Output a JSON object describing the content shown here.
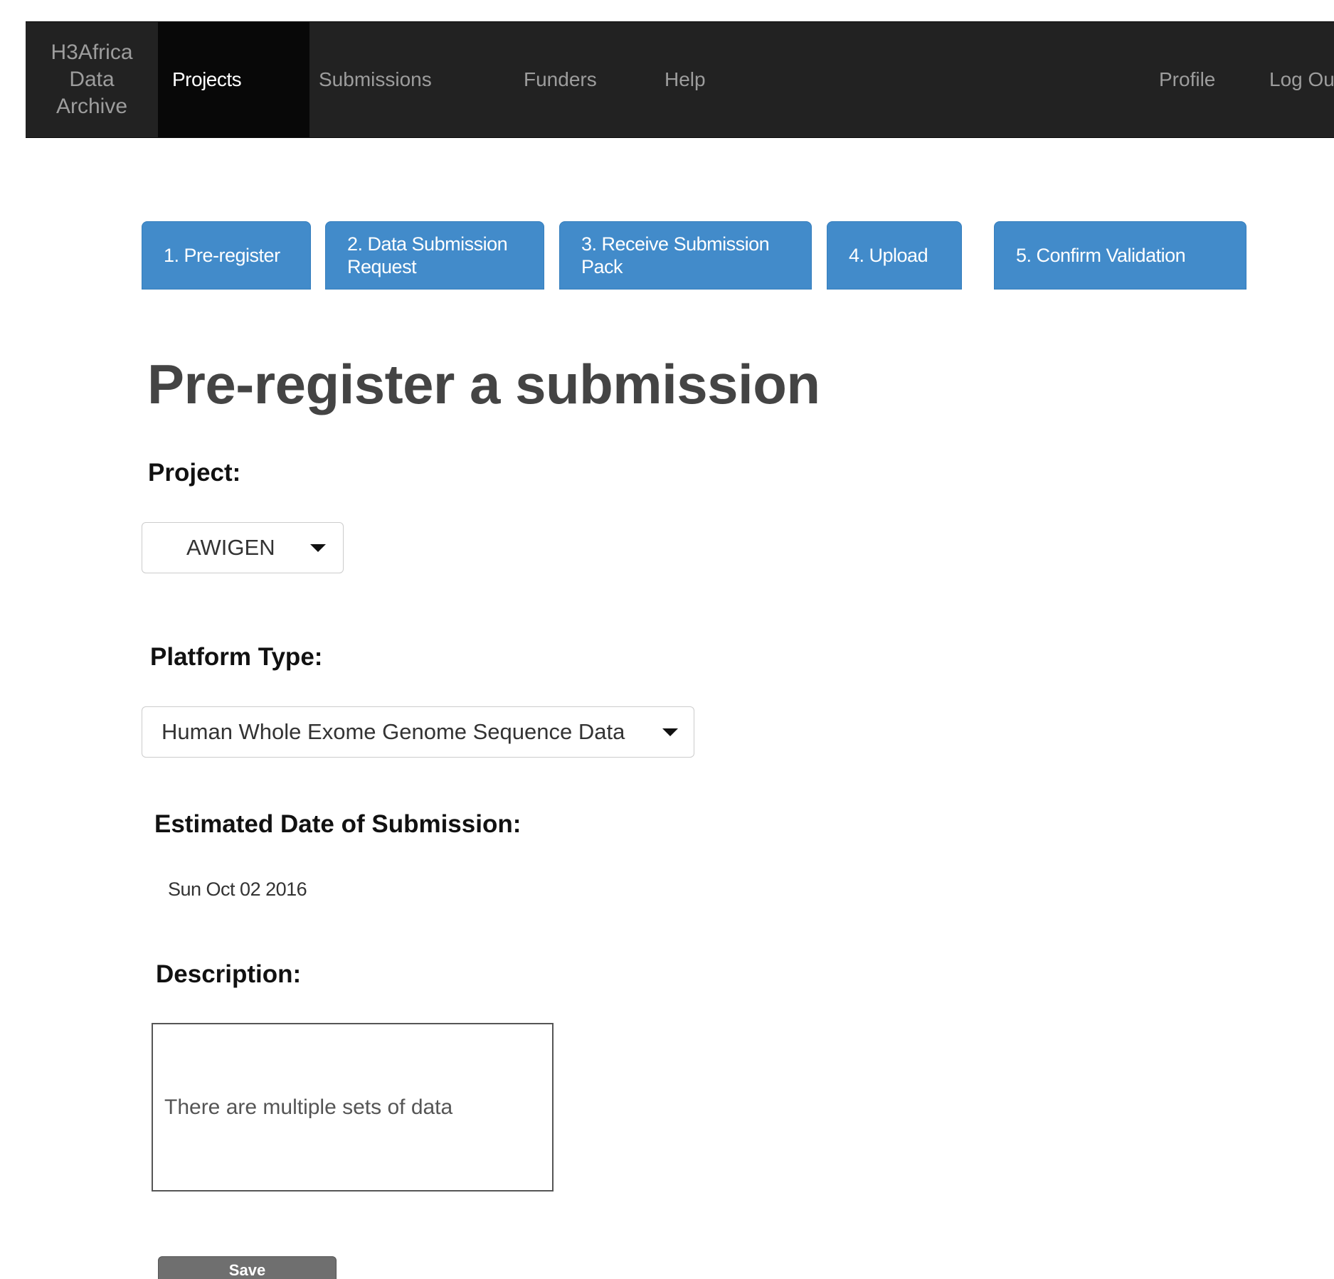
{
  "navbar": {
    "brand": {
      "line1": "H3Africa",
      "line2": "Data",
      "line3": "Archive"
    },
    "items": [
      {
        "label": "Projects",
        "active": true
      },
      {
        "label": "Submissions"
      },
      {
        "label": "Funders"
      },
      {
        "label": "Help"
      }
    ],
    "right_items": [
      {
        "label": "Profile"
      },
      {
        "label": "Log Ou"
      }
    ]
  },
  "steps": [
    {
      "label": "1. Pre-register"
    },
    {
      "label": "2. Data Submission Request"
    },
    {
      "label": "3. Receive Submission Pack"
    },
    {
      "label": "4. Upload"
    },
    {
      "label": "5. Confirm Validation"
    }
  ],
  "main": {
    "title": "Pre-register a submission",
    "project": {
      "label": "Project:",
      "value": "AWIGEN"
    },
    "platform": {
      "label": "Platform Type:",
      "value": "Human Whole Exome Genome Sequence Data"
    },
    "date": {
      "label": "Estimated Date of Submission:",
      "value": "Sun Oct 02 2016"
    },
    "description": {
      "label": "Description:",
      "value": "There are multiple sets of data"
    },
    "save_label": "Save"
  },
  "colors": {
    "navbar_bg": "#222222",
    "navbar_active_bg": "#080808",
    "step_bg": "#428bca",
    "save_bg": "#6f6f6f"
  }
}
